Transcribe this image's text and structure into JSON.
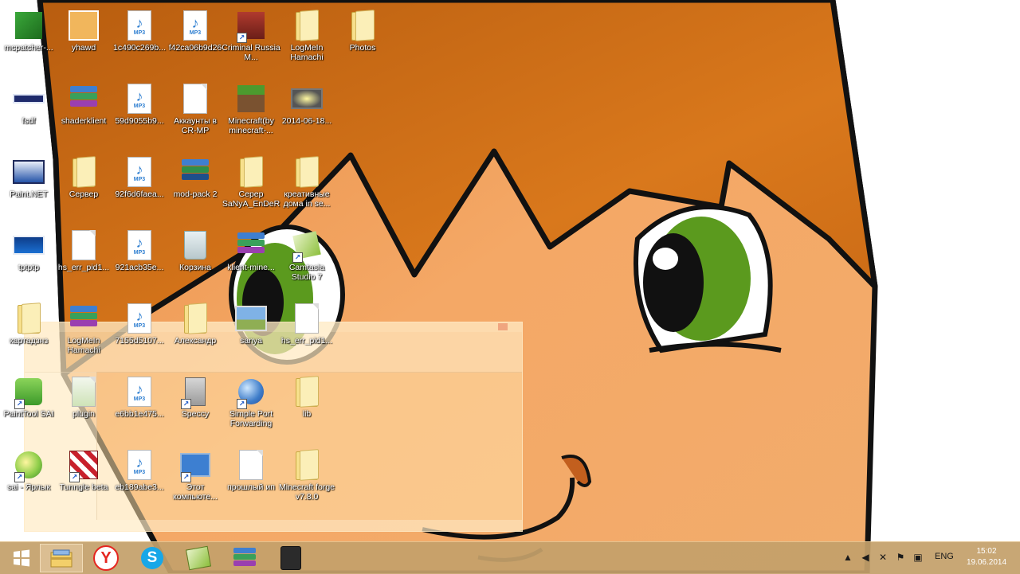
{
  "desktop": {
    "icons": [
      {
        "label": "mcpatcher-...",
        "icon": "minecraft-patcher-icon",
        "shortcut": false
      },
      {
        "label": "yhawd",
        "icon": "image-file-icon",
        "shortcut": false
      },
      {
        "label": "1c490c269b...",
        "icon": "mp3-file-icon",
        "shortcut": false
      },
      {
        "label": "f42ca06b9d26",
        "icon": "mp3-file-icon",
        "shortcut": false
      },
      {
        "label": "Criminal Russia M...",
        "icon": "game-shortcut-icon",
        "shortcut": true
      },
      {
        "label": "LogMeIn Hamachi",
        "icon": "folder-icon",
        "shortcut": false
      },
      {
        "label": "Photos",
        "icon": "folder-icon",
        "shortcut": false
      },
      {
        "label": "fsdf",
        "icon": "image-file-icon",
        "shortcut": false
      },
      {
        "label": "shaderklient",
        "icon": "winrar-archive-icon",
        "shortcut": false
      },
      {
        "label": "59d9055b9...",
        "icon": "mp3-file-icon",
        "shortcut": false
      },
      {
        "label": "Аккаунты в CR-MP",
        "icon": "text-file-icon",
        "shortcut": false
      },
      {
        "label": "Minecraft(by minecraft-...",
        "icon": "minecraft-block-icon",
        "shortcut": false
      },
      {
        "label": "2014-06-18...",
        "icon": "image-file-icon",
        "shortcut": false
      },
      {
        "label": "Paint.NET",
        "icon": "paintnet-icon",
        "shortcut": false
      },
      {
        "label": "Сервер",
        "icon": "folder-icon",
        "shortcut": false
      },
      {
        "label": "92f6d6faea...",
        "icon": "mp3-file-icon",
        "shortcut": false
      },
      {
        "label": "mod-pack 2",
        "icon": "winrar-archive-icon",
        "shortcut": false
      },
      {
        "label": "Серер SaNyA_EnDeR",
        "icon": "folder-icon",
        "shortcut": false
      },
      {
        "label": "креативные дома in se...",
        "icon": "folder-icon",
        "shortcut": false
      },
      {
        "label": "tptptp",
        "icon": "image-file-icon",
        "shortcut": false
      },
      {
        "label": "hs_err_pid1...",
        "icon": "text-file-icon",
        "shortcut": false
      },
      {
        "label": "921acb35e...",
        "icon": "mp3-file-icon",
        "shortcut": false
      },
      {
        "label": "Корзина",
        "icon": "recycle-bin-icon",
        "shortcut": false
      },
      {
        "label": "klient-mine...",
        "icon": "winrar-archive-icon",
        "shortcut": false
      },
      {
        "label": "Camtasia Studio 7",
        "icon": "camtasia-icon",
        "shortcut": true
      },
      {
        "label": "картадзнз",
        "icon": "folder-icon",
        "shortcut": false
      },
      {
        "label": "LogMeIn Hamachi",
        "icon": "winrar-archive-icon",
        "shortcut": false
      },
      {
        "label": "7155d5107...",
        "icon": "mp3-file-icon",
        "shortcut": false
      },
      {
        "label": "Александр",
        "icon": "user-folder-icon",
        "shortcut": false
      },
      {
        "label": "sanya",
        "icon": "image-file-icon",
        "shortcut": false
      },
      {
        "label": "hs_err_pid1...",
        "icon": "text-file-icon",
        "shortcut": false
      },
      {
        "label": "PaintTool SAI",
        "icon": "painttool-sai-icon",
        "shortcut": true
      },
      {
        "label": "plugin",
        "icon": "plugin-icon",
        "shortcut": false
      },
      {
        "label": "e6bb1e475...",
        "icon": "mp3-file-icon",
        "shortcut": false
      },
      {
        "label": "Speccy",
        "icon": "speccy-icon",
        "shortcut": true
      },
      {
        "label": "Simple Port Forwarding",
        "icon": "globe-icon",
        "shortcut": true
      },
      {
        "label": "lib",
        "icon": "folder-icon",
        "shortcut": false
      },
      {
        "label": "sai - Ярлык",
        "icon": "sai-shortcut-icon",
        "shortcut": true
      },
      {
        "label": "Tunngle beta",
        "icon": "tunngle-icon",
        "shortcut": true
      },
      {
        "label": "eb189abe3...",
        "icon": "mp3-file-icon",
        "shortcut": false
      },
      {
        "label": "Этот компьюте...",
        "icon": "this-pc-icon",
        "shortcut": true
      },
      {
        "label": "прошлый ип",
        "icon": "text-file-icon",
        "shortcut": false
      },
      {
        "label": "Minecraft forge v7.8.0",
        "icon": "folder-icon",
        "shortcut": false
      }
    ]
  },
  "taskbar": {
    "buttons": [
      {
        "name": "windows-start-button",
        "icon": "windows-logo-icon"
      },
      {
        "name": "taskbar-file-explorer",
        "icon": "file-explorer-icon"
      },
      {
        "name": "taskbar-yandex-browser",
        "icon": "yandex-browser-icon"
      },
      {
        "name": "taskbar-skype",
        "icon": "skype-icon"
      },
      {
        "name": "taskbar-camtasia",
        "icon": "camtasia-icon"
      },
      {
        "name": "taskbar-winrar",
        "icon": "winrar-icon"
      },
      {
        "name": "taskbar-camtasia-recorder",
        "icon": "camtasia-recorder-icon"
      }
    ],
    "tray": {
      "icons": [
        "show-hidden-icons-chevron-icon",
        "volume-icon",
        "network-icon",
        "flag-icon",
        "removable-device-icon",
        "battery-icon"
      ],
      "language": "ENG",
      "time": "15:02",
      "date": "19.06.2014"
    }
  },
  "colors": {
    "wallpaper_orange": "#d9781c",
    "wallpaper_skin": "#f0a35e",
    "eye_green": "#5b9a1e",
    "taskbar": "#c4a06a"
  }
}
